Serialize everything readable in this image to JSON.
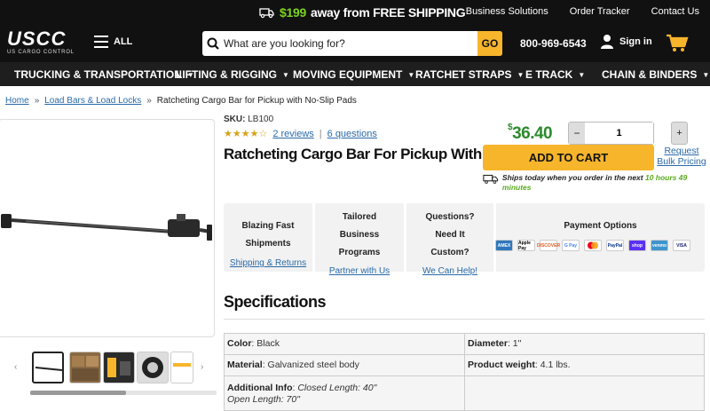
{
  "promo": {
    "amount": "$199",
    "text": "away from FREE SHIPPING",
    "links": [
      "Business Solutions",
      "Order Tracker",
      "Contact Us"
    ]
  },
  "header": {
    "logo_text": "USCC",
    "logo_sub": "US CARGO CONTROL",
    "menu_label": "ALL",
    "search_placeholder": "What are you looking for?",
    "search_button": "GO",
    "phone": "800-969-6543",
    "signin": "Sign in"
  },
  "nav": [
    "TRUCKING & TRANSPORTATION",
    "LIFTING & RIGGING",
    "MOVING EQUIPMENT",
    "RATCHET STRAPS",
    "E TRACK",
    "CHAIN & BINDERS"
  ],
  "breadcrumb": [
    "Home",
    "Load Bars & Load Locks",
    "Ratcheting Cargo Bar for Pickup with No-Slip Pads"
  ],
  "product": {
    "sku_label": "SKU:",
    "sku": "LB100",
    "rating": 4,
    "reviews": "2 reviews",
    "questions": "6 questions",
    "title": "Ratcheting Cargo Bar For Pickup With No-Slip Pads",
    "price_symbol": "$",
    "price": "36.40",
    "quantity": "1",
    "add_to_cart": "ADD TO CART",
    "bulk": "Request Bulk Pricing",
    "ship_text": "Ships today when you order in the next",
    "ship_time": "10 hours 49 minutes"
  },
  "props": {
    "p1_title": "Blazing Fast Shipments",
    "p1_link": "Shipping & Returns",
    "p2_title": "Tailored Business Programs",
    "p2_link": "Partner with Us",
    "p3_title": "Questions? Need It Custom?",
    "p3_link": "We Can Help!",
    "p4_title": "Payment Options",
    "payments": [
      "AMEX",
      "Apple Pay",
      "DISCOVER",
      "G Pay",
      "MC",
      "PayPal",
      "shop",
      "venmo",
      "VISA"
    ]
  },
  "specs": {
    "heading": "Specifications",
    "rows": [
      [
        {
          "k": "Color",
          "v": "Black"
        },
        {
          "k": "Diameter",
          "v": "1\""
        }
      ],
      [
        {
          "k": "Material",
          "v": "Galvanized steel body"
        },
        {
          "k": "Product weight",
          "v": "4.1 lbs."
        }
      ],
      [
        {
          "k": "Additional Info",
          "v": "Closed Length: 40\"",
          "v2": "Open Length: 70\""
        },
        {
          "k": "",
          "v": ""
        }
      ]
    ]
  },
  "colors": {
    "accent": "#f7b52c",
    "link": "#2a6aa8",
    "price": "#2c8a2c",
    "header_bg": "#111111"
  }
}
